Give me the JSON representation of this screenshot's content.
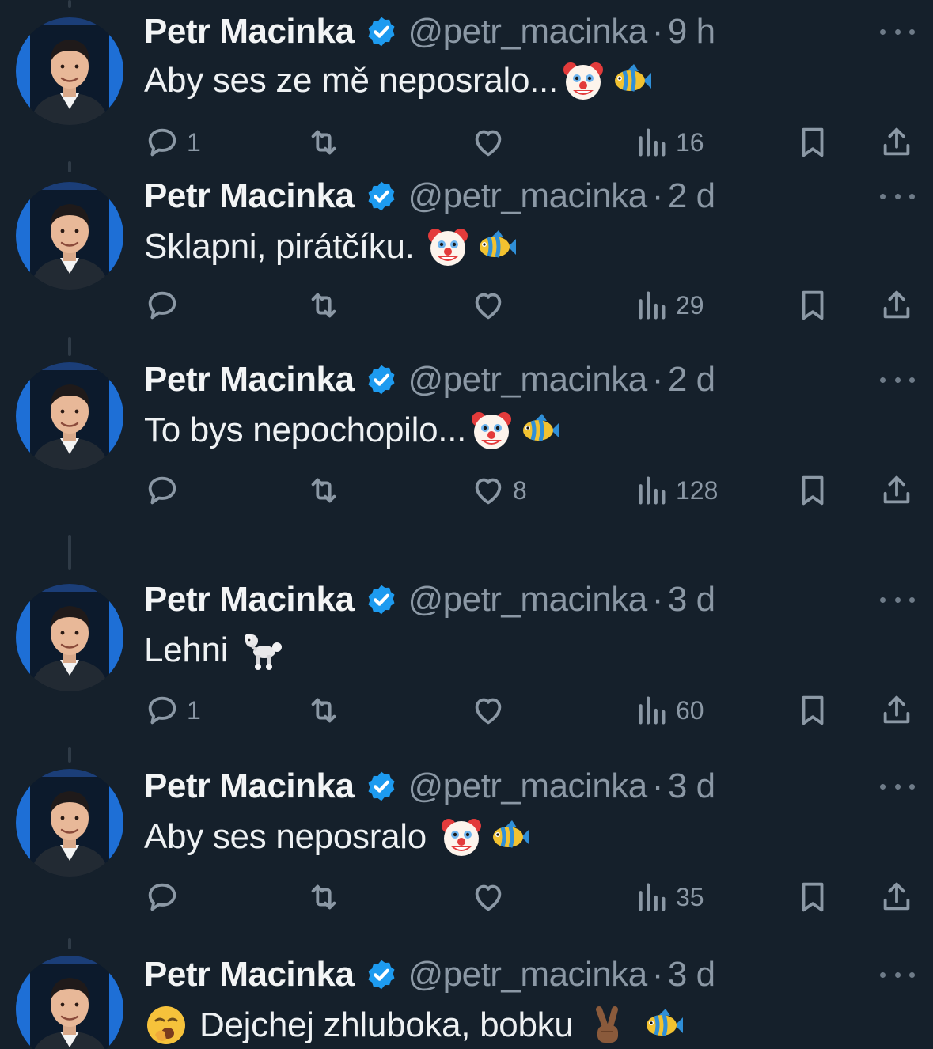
{
  "colors": {
    "background": "#15202b",
    "text": "#e7e9ea",
    "muted": "#8b98a5",
    "verified": "#1d9bf0"
  },
  "tweets": [
    {
      "name": "Petr Macinka",
      "handle": "@petr_macinka",
      "separator": "·",
      "time": "9 h",
      "text": "Aby ses ze mě neposralo...",
      "emoji": [
        "clown-face",
        "tropical-fish"
      ],
      "reply_count": "1",
      "retweet_count": "",
      "like_count": "",
      "views": "16"
    },
    {
      "name": "Petr Macinka",
      "handle": "@petr_macinka",
      "separator": "·",
      "time": "2 d",
      "text": "Sklapni, pirátčíku.",
      "emoji": [
        "clown-face",
        "tropical-fish"
      ],
      "reply_count": "",
      "retweet_count": "",
      "like_count": "",
      "views": "29"
    },
    {
      "name": "Petr Macinka",
      "handle": "@petr_macinka",
      "separator": "·",
      "time": "2 d",
      "text": "To bys nepochopilo...",
      "emoji": [
        "clown-face",
        "tropical-fish"
      ],
      "reply_count": "",
      "retweet_count": "",
      "like_count": "8",
      "views": "128"
    },
    {
      "name": "Petr Macinka",
      "handle": "@petr_macinka",
      "separator": "·",
      "time": "3 d",
      "text": "Lehni",
      "emoji": [
        "poodle"
      ],
      "reply_count": "1",
      "retweet_count": "",
      "like_count": "",
      "views": "60"
    },
    {
      "name": "Petr Macinka",
      "handle": "@petr_macinka",
      "separator": "·",
      "time": "3 d",
      "text": "Aby ses neposralo",
      "emoji": [
        "clown-face",
        "tropical-fish"
      ],
      "reply_count": "",
      "retweet_count": "",
      "like_count": "",
      "views": "35"
    },
    {
      "name": "Petr Macinka",
      "handle": "@petr_macinka",
      "separator": "·",
      "time": "3 d",
      "text": "Dejchej zhluboka, bobku",
      "emoji_lead": [
        "yawning-face"
      ],
      "emoji": [
        "victory-hand",
        "tropical-fish"
      ],
      "reply_count": "",
      "retweet_count": "",
      "like_count": "",
      "views": ""
    }
  ]
}
